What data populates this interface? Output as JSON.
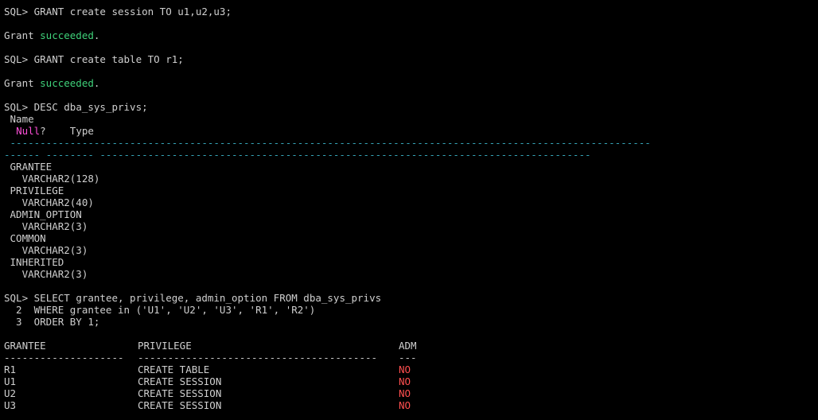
{
  "terminal": {
    "lines": {
      "cmd1_prompt": "SQL> ",
      "cmd1_text": "GRANT create session TO u1,u2,u3;",
      "grant1_prefix": "Grant ",
      "grant1_status": "succeeded",
      "grant1_suffix": ".",
      "cmd2_prompt": "SQL> ",
      "cmd2_text": "GRANT create table TO r1;",
      "grant2_prefix": "Grant ",
      "grant2_status": "succeeded",
      "grant2_suffix": ".",
      "cmd3_prompt": "SQL> ",
      "cmd3_text": "DESC dba_sys_privs;"
    },
    "desc": {
      "header_name": " Name",
      "header_null_indent": "  ",
      "header_null": "Null",
      "header_null_q": "?",
      "header_type": "    Type",
      "dash_line_1": " -----------------------------------------------------------------------------------------------------------",
      "dash_line_2": "------ -------- ----------------------------------------------------------------------------------",
      "columns": [
        {
          "name": " GRANTEE",
          "type": "   VARCHAR2(128)"
        },
        {
          "name": " PRIVILEGE",
          "type": "   VARCHAR2(40)"
        },
        {
          "name": " ADMIN_OPTION",
          "type": "   VARCHAR2(3)"
        },
        {
          "name": " COMMON",
          "type": "   VARCHAR2(3)"
        },
        {
          "name": " INHERITED",
          "type": "   VARCHAR2(3)"
        }
      ]
    },
    "query": {
      "line1_prompt": "SQL> ",
      "line1_text": "SELECT grantee, privilege, admin_option FROM dba_sys_privs",
      "line2": "  2  WHERE grantee in ('U1', 'U2', 'U3', 'R1', 'R2')",
      "line3": "  3  ORDER BY 1;"
    },
    "result": {
      "headers": {
        "grantee": "GRANTEE",
        "privilege": "PRIVILEGE",
        "adm": "ADM"
      },
      "dashes": {
        "grantee": "--------------------",
        "privilege": "----------------------------------------",
        "adm": "---"
      },
      "rows": [
        {
          "grantee": "R1",
          "privilege": "CREATE TABLE",
          "adm": "NO"
        },
        {
          "grantee": "U1",
          "privilege": "CREATE SESSION",
          "adm": "NO"
        },
        {
          "grantee": "U2",
          "privilege": "CREATE SESSION",
          "adm": "NO"
        },
        {
          "grantee": "U3",
          "privilege": "CREATE SESSION",
          "adm": "NO"
        }
      ]
    },
    "colors": {
      "background": "#000000",
      "text": "#cfcfcf",
      "success": "#3fd27a",
      "null_keyword": "#ff4fd8",
      "dash_accent": "#35a3b6",
      "no_value": "#ff4f4f"
    }
  }
}
